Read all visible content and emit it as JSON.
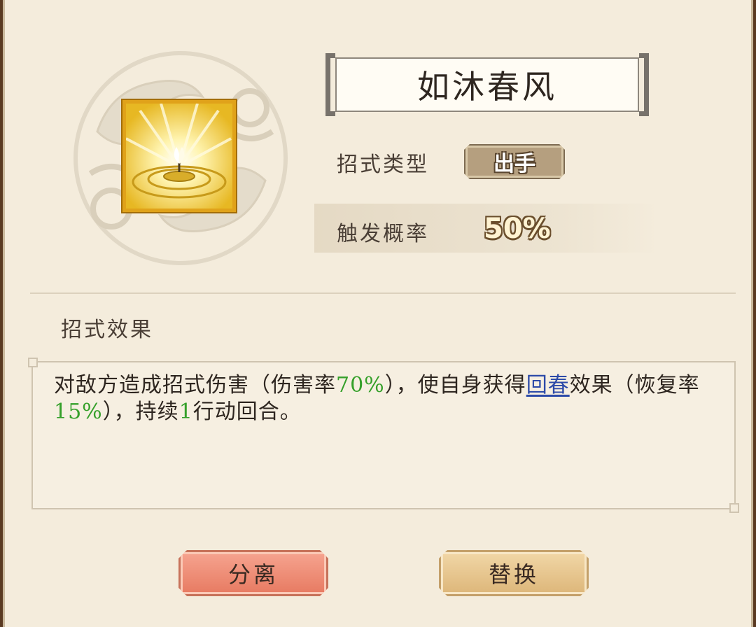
{
  "skill": {
    "name": "如沐春风",
    "type_label": "招式类型",
    "type_value": "出手",
    "trigger_label": "触发概率",
    "trigger_value": "50%"
  },
  "effect": {
    "section_title": "招式效果",
    "segments": {
      "s1": "对敌方造成招式伤害（伤害率",
      "s2": "70%",
      "s3": "），使自身获得",
      "s4": "回春",
      "s5": "效果（恢复率",
      "s6": "15%",
      "s7": "），持续",
      "s8": "1",
      "s9": "行动回合。"
    }
  },
  "buttons": {
    "separate_label": "分离",
    "replace_label": "替换"
  },
  "colors": {
    "highlight_green": "#35a02a",
    "link_blue": "#2c4aa8",
    "separate_button": "#e77a61",
    "replace_button": "#ddb679",
    "icon_border": "#e0a21a"
  },
  "icons": {
    "skill_icon": "glowing-candle-lotus-icon",
    "emblem": "cloud-emblem"
  }
}
